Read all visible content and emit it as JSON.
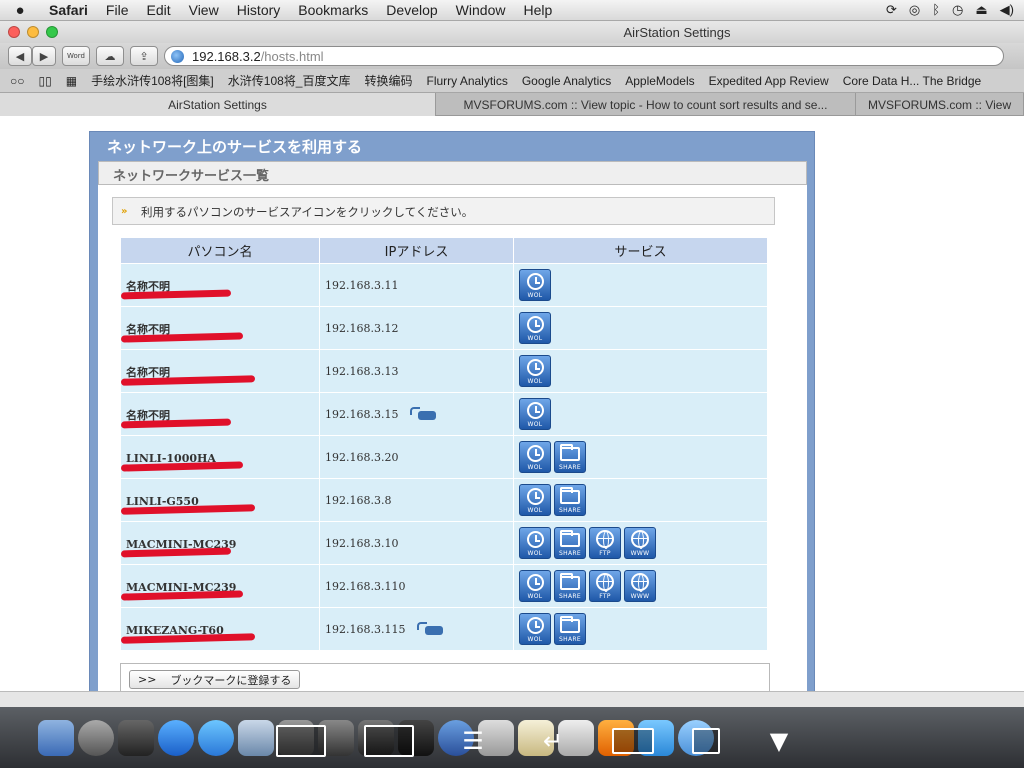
{
  "menubar": {
    "app": "Safari",
    "items": [
      "File",
      "Edit",
      "View",
      "History",
      "Bookmarks",
      "Develop",
      "Window",
      "Help"
    ]
  },
  "window": {
    "title": "AirStation Settings",
    "url_host": "192.168.3.2",
    "url_path": "/hosts.html",
    "toolbar_word_label": "Word"
  },
  "bookmarks": [
    "手绘水浒传108将[图集]",
    "水浒传108将_百度文库",
    "转换编码",
    "Flurry Analytics",
    "Google Analytics",
    "AppleModels",
    "Expedited App Review",
    "Core Data H... The Bridge"
  ],
  "tabs": [
    {
      "label": "AirStation Settings",
      "active": true
    },
    {
      "label": "MVSFORUMS.com :: View topic - How to count sort results and se...",
      "active": false
    },
    {
      "label": "MVSFORUMS.com :: View",
      "active": false
    }
  ],
  "page": {
    "title": "ネットワーク上のサービスを利用する",
    "subtitle": "ネットワークサービス一覧",
    "instruction": "利用するパソコンのサービスアイコンをクリックしてください。",
    "columns": [
      "パソコン名",
      "IPアドレス",
      "サービス"
    ],
    "hosts": [
      {
        "name": "名称不明",
        "ip": "192.168.3.11",
        "game": false,
        "services": [
          "WOL"
        ]
      },
      {
        "name": "名称不明",
        "ip": "192.168.3.12",
        "game": false,
        "services": [
          "WOL"
        ]
      },
      {
        "name": "名称不明",
        "ip": "192.168.3.13",
        "game": false,
        "services": [
          "WOL"
        ]
      },
      {
        "name": "名称不明",
        "ip": "192.168.3.15",
        "game": true,
        "services": [
          "WOL"
        ]
      },
      {
        "name": "LINLI-1000HA",
        "ip": "192.168.3.20",
        "game": false,
        "services": [
          "WOL",
          "SHARE"
        ]
      },
      {
        "name": "LINLI-G550",
        "ip": "192.168.3.8",
        "game": false,
        "services": [
          "WOL",
          "SHARE"
        ]
      },
      {
        "name": "MACMINI-MC239",
        "ip": "192.168.3.10",
        "game": false,
        "services": [
          "WOL",
          "SHARE",
          "FTP",
          "WWW"
        ]
      },
      {
        "name": "MACMINI-MC239",
        "ip": "192.168.3.110",
        "game": false,
        "services": [
          "WOL",
          "SHARE",
          "FTP",
          "WWW"
        ]
      },
      {
        "name": "MIKEZANG-T60",
        "ip": "192.168.3.115",
        "game": true,
        "services": [
          "WOL",
          "SHARE"
        ]
      }
    ],
    "bookmark_arrow": ">>",
    "bookmark_button": "ブックマークに登録する"
  },
  "colors": {
    "panel": "#7f9fcc",
    "header_cell": "#c6d6ee",
    "row_cell": "#d9eef8",
    "redaction": "#e0102a"
  }
}
